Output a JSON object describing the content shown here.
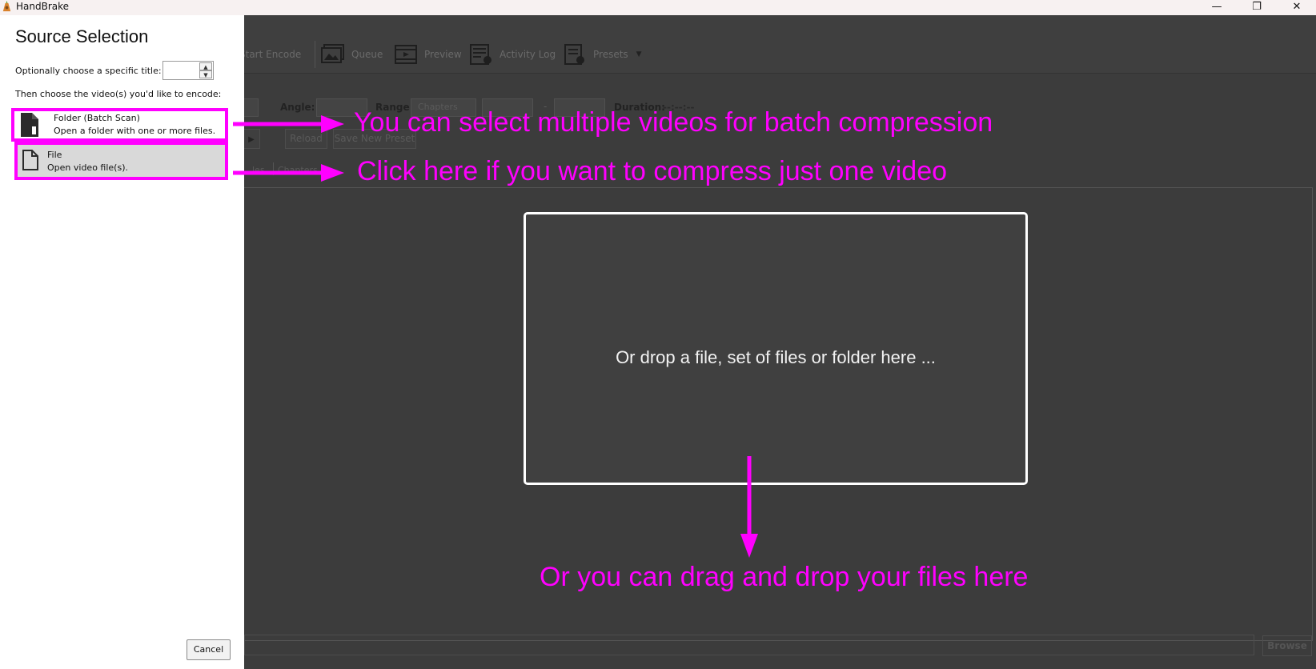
{
  "window": {
    "title": "HandBrake",
    "minimize_glyph": "—",
    "restore_glyph": "❐",
    "close_glyph": "✕"
  },
  "toolbar": {
    "start_encode": "Start Encode",
    "queue": "Queue",
    "preview": "Preview",
    "activity_log": "Activity Log",
    "presets": "Presets"
  },
  "source_row": {
    "angle_label": "Angle:",
    "range_label": "Range:",
    "range_value": "Chapters",
    "range_dash": "-",
    "duration_label": "Duration:",
    "duration_value": "--:--:--"
  },
  "preset_row": {
    "reload": "Reload",
    "save_new_preset": "Save New Preset"
  },
  "tabs": {
    "partial": "les",
    "chapters": "Chapters"
  },
  "drop_zone": {
    "text": "Or drop a file, set of files or folder here ..."
  },
  "bottom": {
    "browse": "Browse"
  },
  "source_selection": {
    "title": "Source Selection",
    "title_choice_label": "Optionally choose a specific title:",
    "title_choice_value": "",
    "instruction": "Then choose the video(s) you'd like to encode:",
    "options": [
      {
        "title": "Folder (Batch Scan)",
        "description": "Open a folder with one or more files.",
        "icon": "folder-icon"
      },
      {
        "title": "File",
        "description": "Open video file(s).",
        "icon": "file-icon"
      }
    ],
    "cancel": "Cancel"
  },
  "annotations": {
    "batch": "You can select multiple videos for batch compression",
    "single": "Click here if you want to compress just one video",
    "drag": "Or you can drag and drop your files here",
    "color": "#ff00ff"
  }
}
